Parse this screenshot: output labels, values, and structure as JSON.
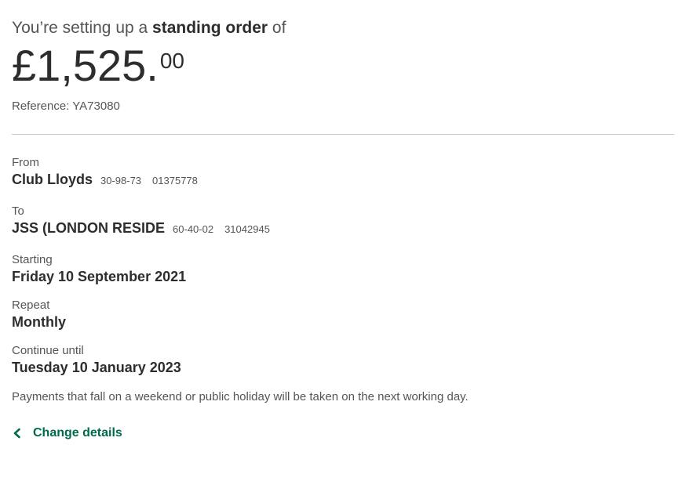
{
  "heading": {
    "prefix": "You’re setting up a",
    "emphasis": "standing order",
    "suffix": "of"
  },
  "amount": {
    "pounds": "£1,525.",
    "pence": "00"
  },
  "reference": "Reference: YA73080",
  "from": {
    "label": "From",
    "name": "Club Lloyds",
    "sort_code": "30-98-73",
    "account_number": "01375778"
  },
  "to": {
    "label": "To",
    "name": "JSS (LONDON RESIDE",
    "sort_code": "60-40-02",
    "account_number": "31042945"
  },
  "starting": {
    "label": "Starting",
    "value": "Friday 10 September 2021"
  },
  "repeat": {
    "label": "Repeat",
    "value": "Monthly"
  },
  "continue_until": {
    "label": "Continue until",
    "value": "Tuesday 10 January 2023"
  },
  "note": "Payments that fall on a weekend or public holiday will be taken on the next working day.",
  "change_link": {
    "label": "Change details",
    "icon": "chevron-left-icon"
  },
  "colors": {
    "link": "#006a4d",
    "text": "#2d2d2d",
    "muted": "#555555",
    "divider": "#cccccc"
  }
}
